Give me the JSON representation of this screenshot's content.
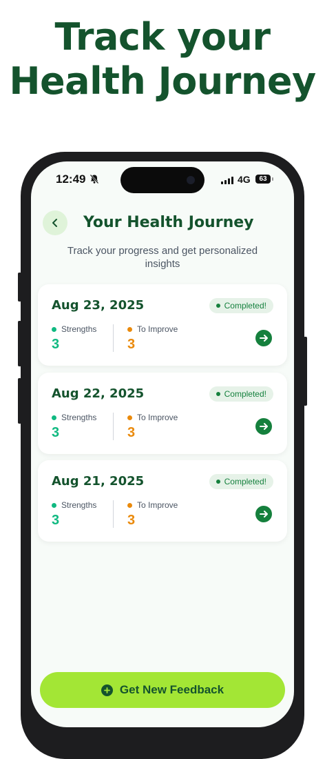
{
  "headline": {
    "line1": "Track your",
    "line2": "Health Journey"
  },
  "status_bar": {
    "time": "12:49",
    "network": "4G",
    "battery": "63"
  },
  "header": {
    "title": "Your Health Journey",
    "subtitle": "Track your progress and get personalized insights"
  },
  "sessions": [
    {
      "date": "Aug 23, 2025",
      "status": "Completed!",
      "strengths_label": "Strengths",
      "strengths_value": "3",
      "improve_label": "To Improve",
      "improve_value": "3"
    },
    {
      "date": "Aug 22, 2025",
      "status": "Completed!",
      "strengths_label": "Strengths",
      "strengths_value": "3",
      "improve_label": "To Improve",
      "improve_value": "3"
    },
    {
      "date": "Aug 21, 2025",
      "status": "Completed!",
      "strengths_label": "Strengths",
      "strengths_value": "3",
      "improve_label": "To Improve",
      "improve_value": "3"
    }
  ],
  "cta": {
    "label": "Get New Feedback"
  },
  "colors": {
    "brand_green": "#14532d",
    "accent_lime": "#a3e635",
    "strength_green": "#10b981",
    "improve_orange": "#ea8a0c"
  },
  "icons": [
    "bell-slash-icon",
    "signal-icon",
    "back-chevron-icon",
    "arrow-right-icon",
    "plus-circle-icon"
  ]
}
